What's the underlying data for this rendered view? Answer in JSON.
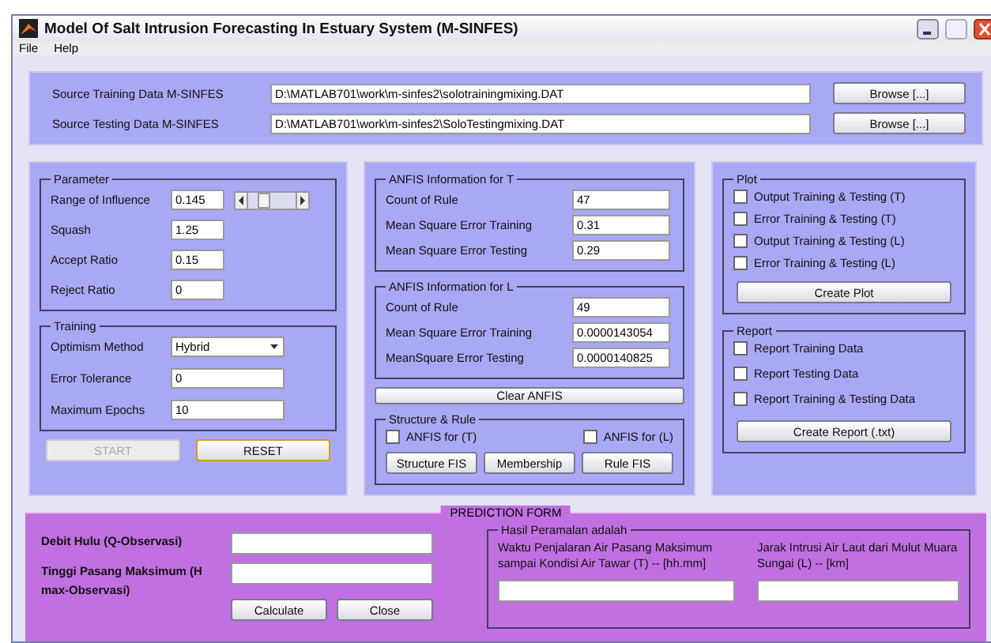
{
  "window": {
    "title": "Model Of Salt Intrusion Forecasting In Estuary System (M-SINFES)"
  },
  "menu": [
    "File",
    "Help"
  ],
  "sources": [
    {
      "label": "Source Training Data M-SINFES",
      "value": "D:\\MATLAB701\\work\\m-sinfes2\\solotrainingmixing.DAT",
      "button": "Browse [...]"
    },
    {
      "label": "Source Testing Data M-SINFES",
      "value": "D:\\MATLAB701\\work\\m-sinfes2\\SoloTestingmixing.DAT",
      "button": "Browse [...]"
    }
  ],
  "parameter": {
    "title": "Parameter",
    "fields": [
      {
        "label": "Range of Influence",
        "value": "0.145",
        "kind": "slider",
        "level": 0.25
      },
      {
        "label": "Squash",
        "value": "1.25",
        "kind": "text"
      },
      {
        "label": "Accept Ratio",
        "value": "0.15",
        "kind": "text"
      },
      {
        "label": "Reject Ratio",
        "value": "0",
        "kind": "text"
      }
    ]
  },
  "training": {
    "title": "Training",
    "fields": [
      {
        "label": "Optimism Method",
        "value": "Hybrid",
        "kind": "dropdown"
      },
      {
        "label": "Error Tolerance",
        "value": "0",
        "kind": "text"
      },
      {
        "label": "Maximum Epochs",
        "value": "10",
        "kind": "text"
      }
    ]
  },
  "actions": [
    {
      "label": "START",
      "disabled": true
    },
    {
      "label": "RESET",
      "disabled": false
    }
  ],
  "anfis": [
    {
      "title": "ANFIS Information for T",
      "rows": [
        {
          "label": "Count of Rule",
          "value": "47"
        },
        {
          "label": "Mean Square Error Training",
          "value": "0.31"
        },
        {
          "label": "Mean Square Error Testing",
          "value": "0.29"
        }
      ]
    },
    {
      "title": "ANFIS Information for L",
      "rows": [
        {
          "label": "Count of Rule",
          "value": "49"
        },
        {
          "label": "Mean Square Error Training",
          "value": "0.0000143054"
        },
        {
          "label": "MeanSquare Error Testing",
          "value": "0.0000140825"
        }
      ]
    }
  ],
  "clear_button": "Clear ANFIS",
  "structure": {
    "title": "Structure & Rule",
    "checks": [
      {
        "label": "ANFIS for (T)",
        "checked": false
      },
      {
        "label": "ANFIS for (L)",
        "checked": false
      }
    ],
    "buttons": [
      "Structure FIS",
      "Membership",
      "Rule FIS"
    ]
  },
  "plot": {
    "title": "Plot",
    "checks": [
      {
        "label": "Output Training & Testing (T)",
        "checked": false
      },
      {
        "label": "Error Training & Testing (T)",
        "checked": false
      },
      {
        "label": "Output Training & Testing (L)",
        "checked": false
      },
      {
        "label": "Error Training & Testing (L)",
        "checked": false
      }
    ],
    "button": "Create Plot"
  },
  "report": {
    "title": "Report",
    "checks": [
      {
        "label": "Report Training Data",
        "checked": false
      },
      {
        "label": "Report Testing Data",
        "checked": false
      },
      {
        "label": "Report Training & Testing Data",
        "checked": false
      }
    ],
    "button": "Create Report (.txt)"
  },
  "prediction": {
    "title": "PREDICTION FORM",
    "inputs": [
      {
        "label": "Debit Hulu (Q-Observasi)"
      },
      {
        "label": "Tinggi Pasang Maksimum (H max-Observasi)"
      }
    ],
    "buttons": [
      "Calculate",
      "Close"
    ],
    "result": {
      "title": "Hasil Peramalan adalah",
      "outputs": [
        {
          "label": "Waktu Penjalaran Air Pasang Maksimum sampai Kondisi Air Tawar (T) -- [hh.mm]"
        },
        {
          "label": "Jarak Intrusi Air Laut dari Mulut Muara Sungai (L) -- [km]"
        }
      ]
    }
  }
}
